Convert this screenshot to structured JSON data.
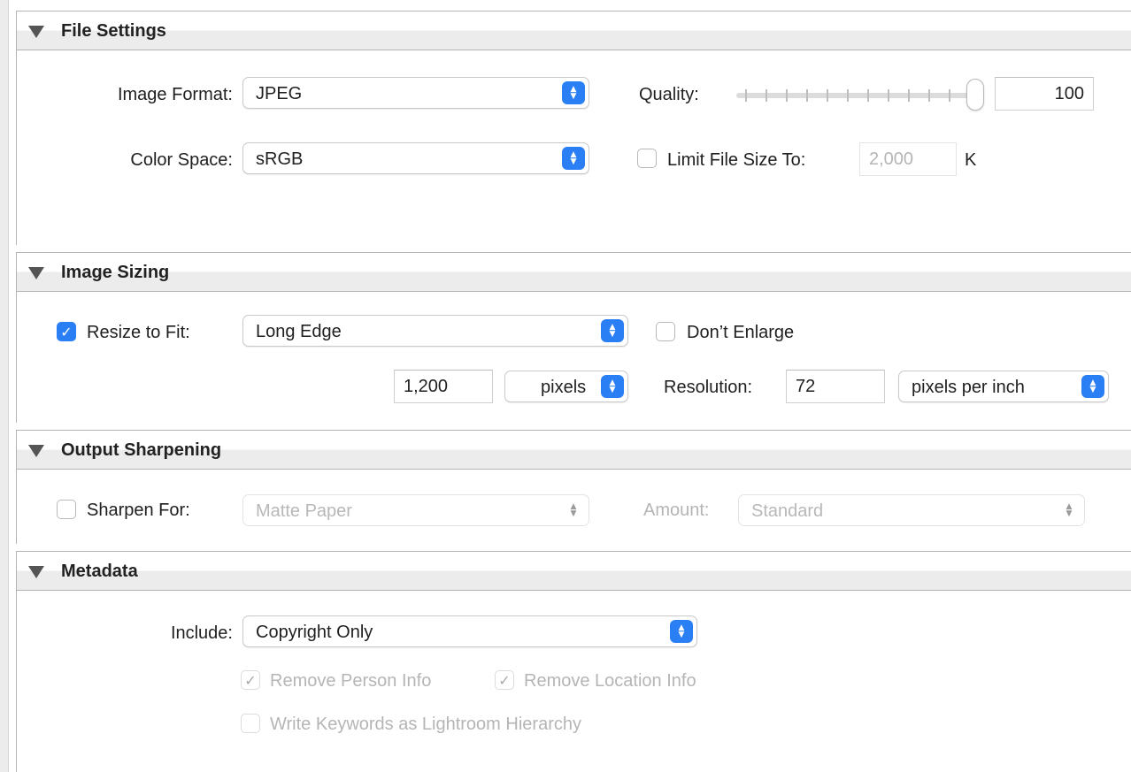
{
  "file_settings": {
    "title": "File Settings",
    "image_format_label": "Image Format:",
    "image_format_value": "JPEG",
    "color_space_label": "Color Space:",
    "color_space_value": "sRGB",
    "quality_label": "Quality:",
    "quality_value": "100",
    "quality_slider_level": 1.0,
    "limit_file_size_label": "Limit File Size To:",
    "limit_file_size_value": "2,000",
    "limit_file_size_unit": "K",
    "limit_file_size_checked": false
  },
  "image_sizing": {
    "title": "Image Sizing",
    "resize_label": "Resize to Fit:",
    "resize_checked": true,
    "resize_mode": "Long Edge",
    "dont_enlarge_label": "Don’t Enlarge",
    "dont_enlarge_checked": false,
    "size_value": "1,200",
    "size_unit": "pixels",
    "resolution_label": "Resolution:",
    "resolution_value": "72",
    "resolution_unit": "pixels per inch"
  },
  "output_sharpening": {
    "title": "Output Sharpening",
    "sharpen_for_label": "Sharpen For:",
    "sharpen_for_checked": false,
    "sharpen_for_value": "Matte Paper",
    "amount_label": "Amount:",
    "amount_value": "Standard"
  },
  "metadata": {
    "title": "Metadata",
    "include_label": "Include:",
    "include_value": "Copyright Only",
    "remove_person_label": "Remove Person Info",
    "remove_location_label": "Remove Location Info",
    "write_keywords_label": "Write Keywords as Lightroom Hierarchy"
  },
  "colors": {
    "accent": "#2b7ff5",
    "header_bg": "#ececec",
    "disabled_text": "#b5b5b5"
  }
}
